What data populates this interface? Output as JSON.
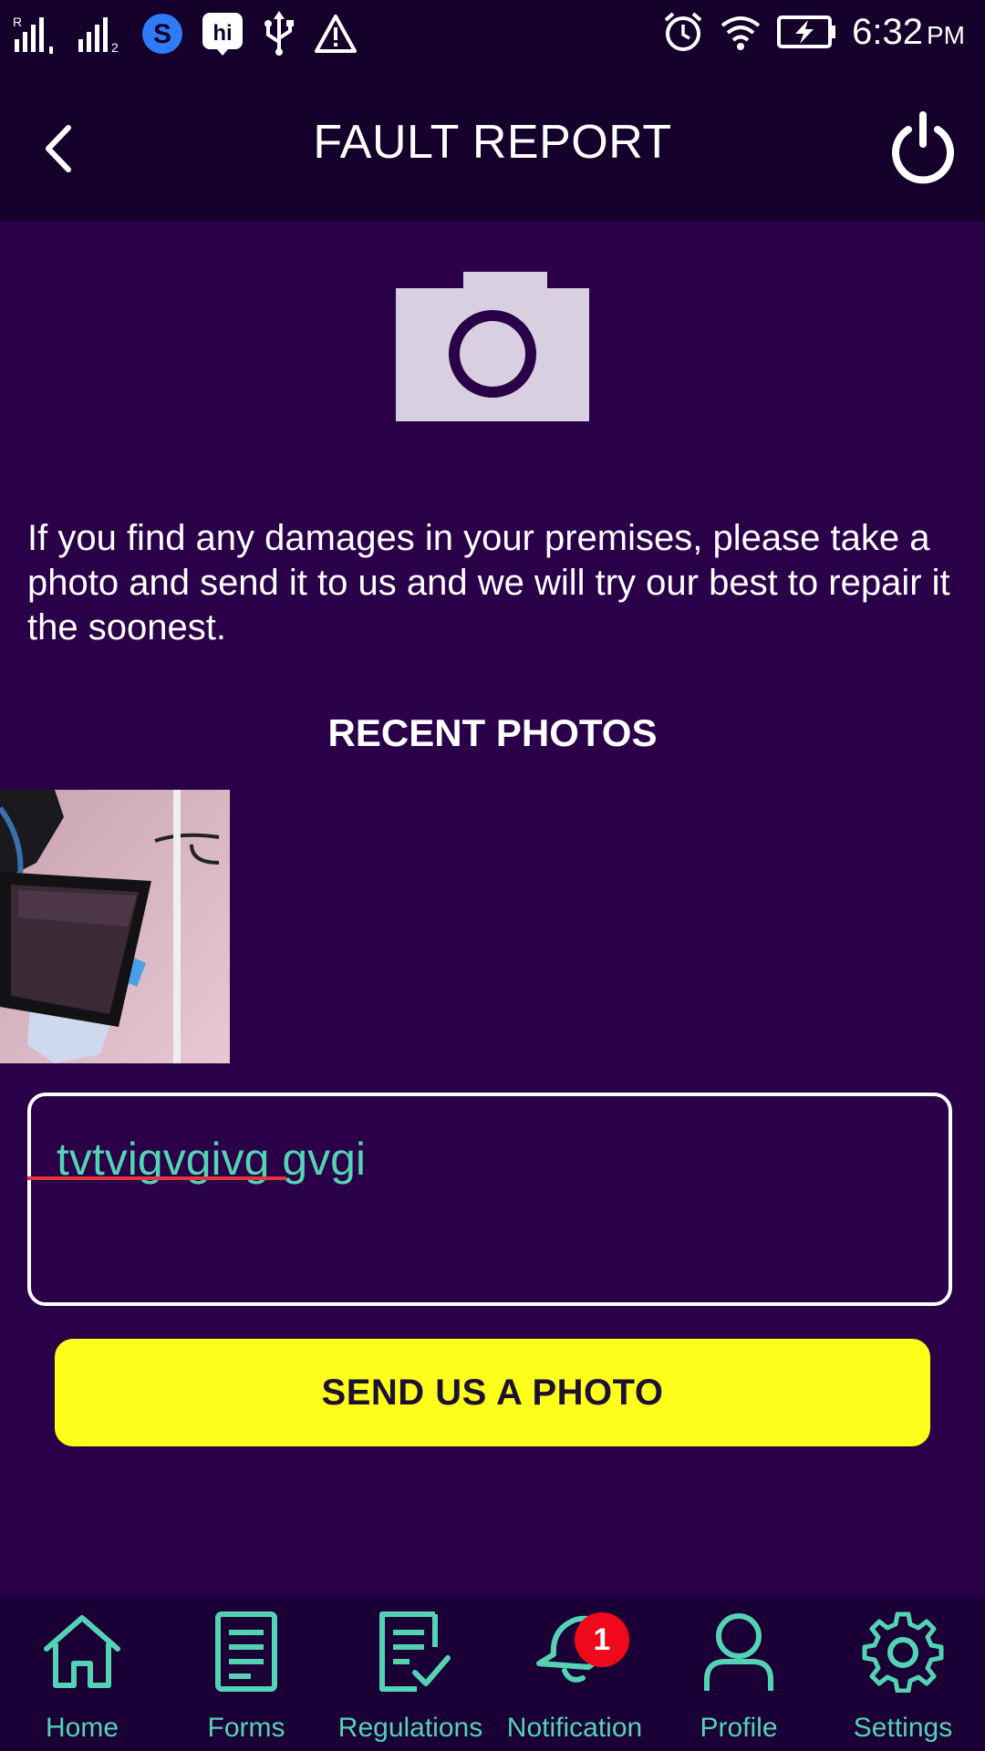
{
  "status_bar": {
    "time": "6:32",
    "ampm": "PM",
    "icons": [
      "signal-r-icon",
      "signal-2-icon",
      "skype-icon",
      "hi-app-icon",
      "usb-icon",
      "warning-icon",
      "alarm-icon",
      "wifi-icon",
      "battery-charging-icon"
    ]
  },
  "header": {
    "title": "FAULT REPORT",
    "back_icon": "chevron-left-icon",
    "power_icon": "power-icon"
  },
  "main": {
    "description": "If you find any damages in your premises, please take a photo and send it to us and we will try our best to repair it the soonest.",
    "recent_title": "RECENT PHOTOS",
    "message_value": "tvtvigvgivg gvgi",
    "send_button_label": "SEND US A PHOTO"
  },
  "nav": {
    "items": [
      {
        "label": "Home",
        "icon": "home-icon"
      },
      {
        "label": "Forms",
        "icon": "document-icon"
      },
      {
        "label": "Regulations",
        "icon": "checklist-icon"
      },
      {
        "label": "Notification",
        "icon": "bell-icon"
      },
      {
        "label": "Profile",
        "icon": "person-icon"
      },
      {
        "label": "Settings",
        "icon": "gear-icon"
      }
    ],
    "notification_badge": "1"
  },
  "colors": {
    "background": "#2a0049",
    "header": "#14002a",
    "accent_teal": "#54d3b4",
    "button_yellow": "#ffff1c",
    "badge_red": "#ee0a1a"
  }
}
